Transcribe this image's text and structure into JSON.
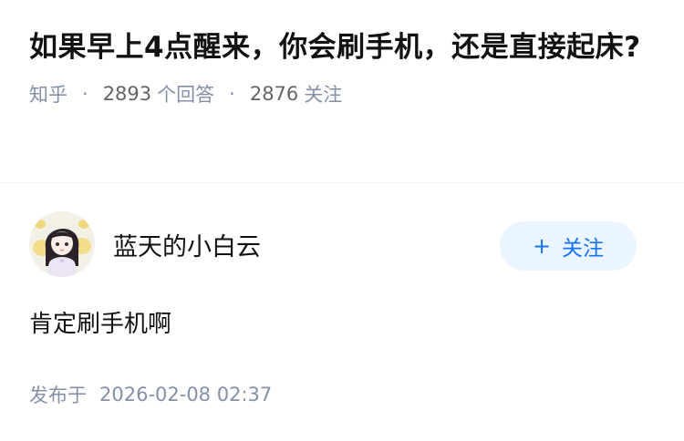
{
  "question": {
    "title": "如果早上4点醒来，你会刷手机，还是直接起床?",
    "source": "知乎",
    "answers_count": "2893",
    "answers_label": "个回答",
    "followers_count": "2876",
    "followers_label": "关注"
  },
  "author": {
    "name": "蓝天的小白云",
    "avatar_icon": "anime-girl-avatar-icon"
  },
  "follow_button": {
    "icon": "+",
    "label": "关注"
  },
  "answer": {
    "content": "肯定刷手机啊"
  },
  "publish": {
    "label": "发布于",
    "datetime": "2026-02-08 02:37"
  },
  "colors": {
    "accent": "#1772f6",
    "accent_bg": "#ebf5ff",
    "meta": "#8590a6",
    "text": "#121212"
  }
}
